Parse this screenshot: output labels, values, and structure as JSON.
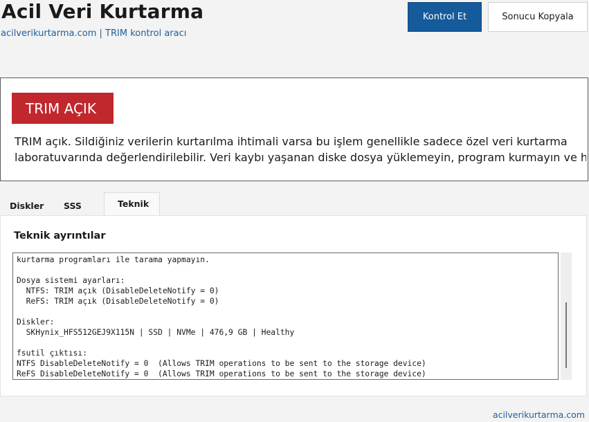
{
  "header": {
    "title": "Acil Veri Kurtarma",
    "subtitle": "acilverikurtarma.com | TRIM kontrol aracı",
    "check_button": "Kontrol Et",
    "copy_button": "Sonucu Kopyala"
  },
  "status": {
    "badge": "TRIM AÇIK",
    "badge_color": "#c0282d",
    "description_lines": [
      "TRIM açık. Sildiğiniz verilerin kurtarılma ihtimali varsa bu işlem genellikle sadece özel veri kurtarma",
      "laboratuvarında değerlendirilebilir. Veri kaybı yaşanan diske dosya yüklemeyin, program kurmayın ve hazır"
    ]
  },
  "tabs": {
    "disks": "Diskler",
    "faq": "SSS",
    "technical": "Teknik",
    "active": "Teknik"
  },
  "technical": {
    "heading": "Teknik ayrıntılar",
    "lines": [
      "kurtarma programları ile tarama yapmayın.",
      "",
      "Dosya sistemi ayarları:",
      "  NTFS: TRIM açık (DisableDeleteNotify = 0)",
      "  ReFS: TRIM açık (DisableDeleteNotify = 0)",
      "",
      "Diskler:",
      "  SKHynix_HFS512GEJ9X115N | SSD | NVMe | 476,9 GB | Healthy",
      "",
      "fsutil çıktısı:",
      "NTFS DisableDeleteNotify = 0  (Allows TRIM operations to be sent to the storage device)",
      "ReFS DisableDeleteNotify = 0  (Allows TRIM operations to be sent to the storage device)"
    ]
  },
  "footer": {
    "link": "acilverikurtarma.com"
  },
  "colors": {
    "primary": "#155a9a",
    "link": "#1e5f99",
    "danger": "#c0282d"
  }
}
